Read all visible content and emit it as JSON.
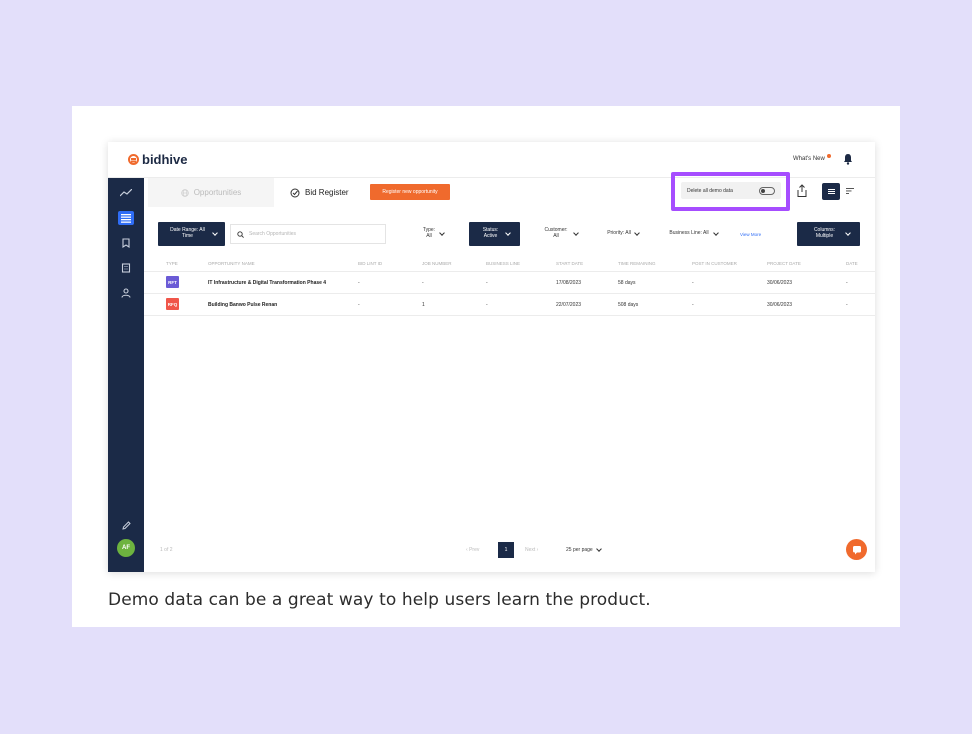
{
  "caption": "Demo data can be a great way to help users learn the product.",
  "brand": {
    "name": "bidhive",
    "color": "#f06a2d"
  },
  "header": {
    "whats_new": "What's New"
  },
  "tabs": {
    "opportunities": "Opportunities",
    "bid_register": "Bid Register"
  },
  "actions": {
    "register": "Register new opportunity",
    "delete_demo": "Delete all demo data"
  },
  "filters": {
    "date_range": "Date Range: All Time",
    "search_placeholder": "Search Opportunities",
    "type": "Type: All",
    "status": "Status: Active",
    "customer": "Customer: All",
    "priority": "Priority: All",
    "business_line": "Business Line: All",
    "view_more": "View More",
    "columns": "Columns: Multiple"
  },
  "table": {
    "headers": [
      "Type",
      "Opportunity Name",
      "Bid Lint ID",
      "Job Number",
      "Business Line",
      "Start Date",
      "Time Remaining",
      "Post In Customer",
      "Project Date",
      "Date"
    ],
    "rows": [
      {
        "type": "RFT",
        "type_color": "#6b5bd6",
        "name": "IT Infrastructure & Digital Transformation Phase 4",
        "bid_id": "-",
        "job": "-",
        "business": "-",
        "start": "17/08/2023",
        "remaining": "58 days",
        "post": "-",
        "project": "30/06/2023",
        "date": "-"
      },
      {
        "type": "RFQ",
        "type_color": "#f0564a",
        "name": "Building Banwo Pulse Renan",
        "bid_id": "-",
        "job": "1",
        "business": "-",
        "start": "22/07/2023",
        "remaining": "508 days",
        "post": "-",
        "project": "30/06/2023",
        "date": "-"
      }
    ]
  },
  "pagination": {
    "count": "1 of 2",
    "prev": "Prev",
    "current": "1",
    "next": "Next",
    "per_page": "25 per page"
  },
  "user": {
    "initials": "AF"
  }
}
